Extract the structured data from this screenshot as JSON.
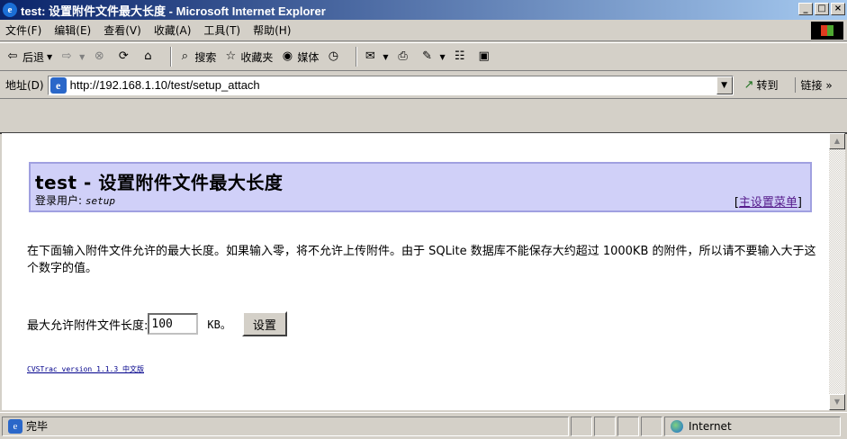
{
  "window": {
    "title": "test: 设置附件文件最大长度 - Microsoft Internet Explorer",
    "buttons": [
      "_",
      "□",
      "×"
    ]
  },
  "menu": [
    "文件(F)",
    "编辑(E)",
    "查看(V)",
    "收藏(A)",
    "工具(T)",
    "帮助(H)"
  ],
  "toolbar": {
    "back": "后退",
    "search": "搜索",
    "favorites": "收藏夹",
    "media": "媒体"
  },
  "address": {
    "label": "地址(D)",
    "url": "http://192.168.1.10/test/setup_attach",
    "go": "转到",
    "links": "链接"
  },
  "page": {
    "title": "test - 设置附件文件最大长度",
    "login_label": "登录用户:",
    "login_user": "setup",
    "main_menu_open": "[",
    "main_menu_link": "主设置菜单",
    "main_menu_close": "]",
    "description": "在下面输入附件文件允许的最大长度。如果输入零，将不允许上传附件。由于 SQLite 数据库不能保存大约超过 1000KB 的附件，所以请不要输入大于这个数字的值。",
    "field_label": "最大允许附件文件长度:",
    "field_value": "100",
    "unit": "KB。",
    "submit": "设置",
    "version": "CVSTrac version 1.1.3 中文版"
  },
  "status": {
    "text": "完毕",
    "zone": "Internet"
  }
}
